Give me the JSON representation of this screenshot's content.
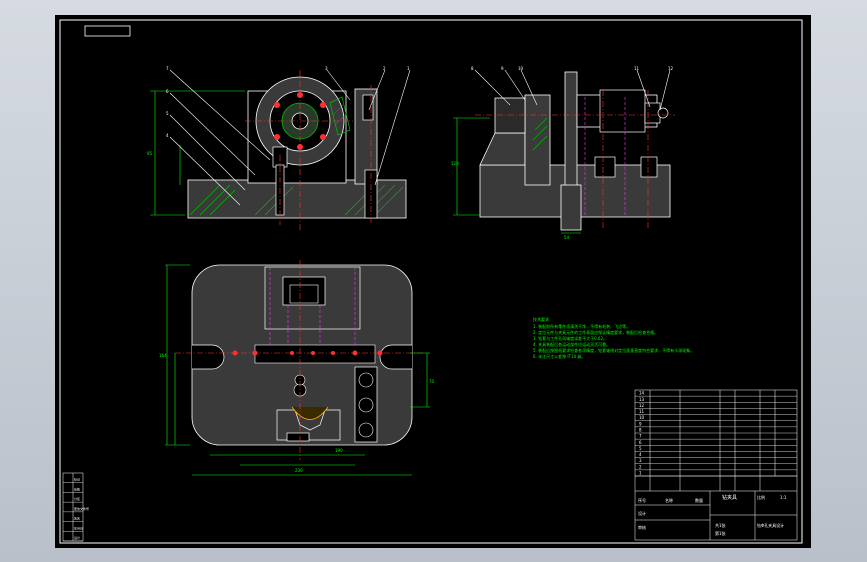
{
  "drawing": {
    "background": "#000000",
    "line_color": "#ffffff",
    "dim_color": "#00ff00",
    "center_color": "#ff3030",
    "hidden_color": "#ff30ff",
    "section_color": "#00c000",
    "dark_fill": "#3a3a3a"
  },
  "title_block": {
    "title": "钻夹具",
    "subtitle": "钻Φ孔夹具设计",
    "label_a": "共1张",
    "label_b": "第1张",
    "label_c": "比例",
    "scale": "1:1",
    "designer": "设计",
    "checker": "审核",
    "standard": "标准化",
    "approve": "批准",
    "weight": "重量"
  },
  "parts_list": {
    "rows": [
      "14",
      "13",
      "12",
      "11",
      "10",
      "9",
      "8",
      "7",
      "6",
      "5",
      "4",
      "3",
      "2",
      "1"
    ],
    "header_no": "序号",
    "header_name": "名称",
    "header_qty": "数量"
  },
  "notes": {
    "title": "技术要求",
    "lines": [
      "1. 装配前所有零件须清洗干净，不得有毛刺、飞边等。",
      "2. 定位元件与夹紧元件的工作表面应保证精度要求，装配后检查合格。",
      "3. 钻套与工件孔同轴度误差不大于0.02。",
      "4. 夹具装配后各运动部件应运动灵活可靠。",
      "5. 装配后按图纸要求检查各项精度，钻套轴线对定位面垂直度符合要求，不得有卡滞现象。",
      "6. 未注尺寸公差按 IT14 级。"
    ]
  },
  "left_table": {
    "rows": [
      "标记",
      "处数",
      "分区",
      "更改文件号",
      "签名",
      "年月日",
      "设计"
    ]
  },
  "dims": {
    "d1": "95",
    "d2": "120",
    "d3": "54",
    "d4": "230",
    "d5": "164",
    "d6": "70",
    "d7": "190"
  },
  "balloons": [
    "1",
    "2",
    "3",
    "4",
    "5",
    "6",
    "7",
    "8",
    "9",
    "10",
    "11",
    "12",
    "13",
    "14"
  ]
}
